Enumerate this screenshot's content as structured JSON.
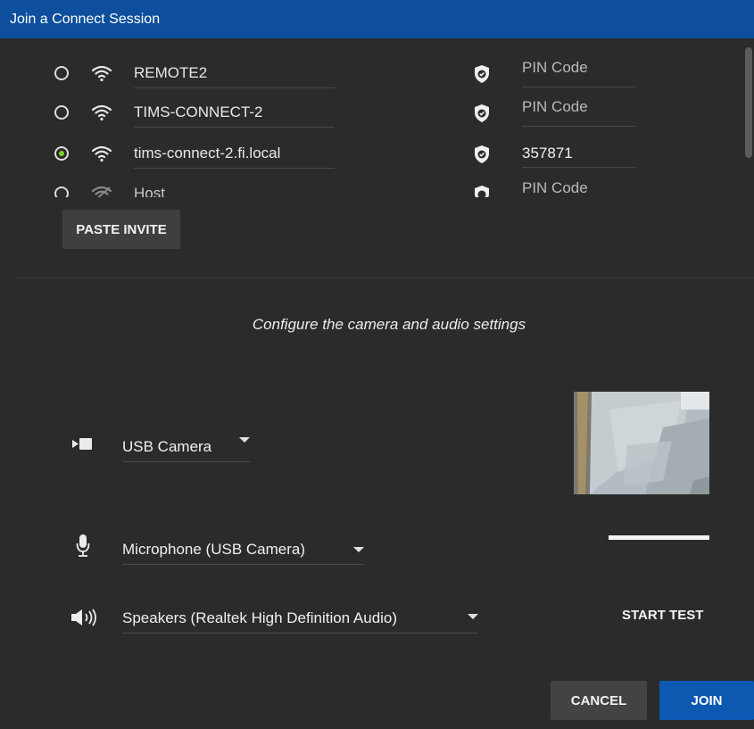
{
  "dialog": {
    "title": "Join a Connect Session"
  },
  "sessions": [
    {
      "name": "REMOTE2",
      "pin": "PIN Code",
      "pin_is_placeholder": true,
      "selected": false,
      "wifi": "wifi-icon"
    },
    {
      "name": "TIMS-CONNECT-2",
      "pin": "PIN Code",
      "pin_is_placeholder": true,
      "selected": false,
      "wifi": "wifi-icon"
    },
    {
      "name": "tims-connect-2.fi.local",
      "pin": "357871",
      "pin_is_placeholder": false,
      "selected": true,
      "wifi": "wifi-icon"
    },
    {
      "name": "Host",
      "pin": "PIN Code",
      "pin_is_placeholder": true,
      "selected": false,
      "wifi": "wifi-off-icon"
    }
  ],
  "paste_invite_label": "PASTE INVITE",
  "config": {
    "title": "Configure the camera and audio settings",
    "camera": {
      "selected": "USB Camera"
    },
    "microphone": {
      "selected": "Microphone (USB Camera)"
    },
    "speakers": {
      "selected": "Speakers (Realtek High Definition Audio)"
    },
    "start_test_label": "START TEST"
  },
  "actions": {
    "cancel_label": "CANCEL",
    "join_label": "JOIN"
  },
  "colors": {
    "titlebar": "#0d4f9c",
    "accent_selected": "#7ed321",
    "join_button": "#0d58b0",
    "background": "#2b2b2b"
  }
}
